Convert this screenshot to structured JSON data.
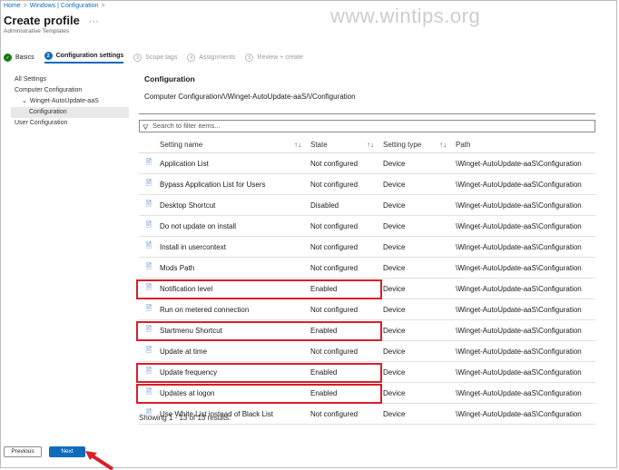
{
  "breadcrumb": [
    "Home",
    "Windows | Configuration"
  ],
  "page_title": "Create profile",
  "subtitle": "Administrative Templates",
  "watermark": "www.wintips.org",
  "steps": [
    {
      "label": "Basics",
      "state": "done",
      "num": "✓"
    },
    {
      "label": "Configuration settings",
      "state": "active",
      "num": "2"
    },
    {
      "label": "Scope tags",
      "state": "pending",
      "num": "3"
    },
    {
      "label": "Assignments",
      "state": "pending",
      "num": "4"
    },
    {
      "label": "Review + create",
      "state": "pending",
      "num": "5"
    }
  ],
  "tree": [
    {
      "label": "All Settings",
      "indent": 0
    },
    {
      "label": "Computer Configuration",
      "indent": 0
    },
    {
      "label": "Winget-AutoUpdate-aaS",
      "indent": 1
    },
    {
      "label": "Configuration",
      "indent": 2,
      "selected": true
    },
    {
      "label": "User Configuration",
      "indent": 0
    }
  ],
  "section_title": "Configuration",
  "section_path": "Computer Configuration/\\/Winget-AutoUpdate-aaS/\\/Configuration",
  "filter_placeholder": "Search to filter items...",
  "columns": {
    "setting": "Setting name",
    "state": "State",
    "type": "Setting type",
    "path": "Path"
  },
  "rows": [
    {
      "name": "Application List",
      "state": "Not configured",
      "type": "Device",
      "path": "\\Winget-AutoUpdate-aaS\\Configuration"
    },
    {
      "name": "Bypass Application List for Users",
      "state": "Not configured",
      "type": "Device",
      "path": "\\Winget-AutoUpdate-aaS\\Configuration"
    },
    {
      "name": "Desktop Shortcut",
      "state": "Disabled",
      "type": "Device",
      "path": "\\Winget-AutoUpdate-aaS\\Configuration"
    },
    {
      "name": "Do not update on install",
      "state": "Not configured",
      "type": "Device",
      "path": "\\Winget-AutoUpdate-aaS\\Configuration"
    },
    {
      "name": "Install in usercontext",
      "state": "Not configured",
      "type": "Device",
      "path": "\\Winget-AutoUpdate-aaS\\Configuration"
    },
    {
      "name": "Mods Path",
      "state": "Not configured",
      "type": "Device",
      "path": "\\Winget-AutoUpdate-aaS\\Configuration"
    },
    {
      "name": "Notification level",
      "state": "Enabled",
      "type": "Device",
      "path": "\\Winget-AutoUpdate-aaS\\Configuration",
      "highlight": true
    },
    {
      "name": "Run on metered connection",
      "state": "Not configured",
      "type": "Device",
      "path": "\\Winget-AutoUpdate-aaS\\Configuration"
    },
    {
      "name": "Startmenu Shortcut",
      "state": "Enabled",
      "type": "Device",
      "path": "\\Winget-AutoUpdate-aaS\\Configuration",
      "highlight": true
    },
    {
      "name": "Update at time",
      "state": "Not configured",
      "type": "Device",
      "path": "\\Winget-AutoUpdate-aaS\\Configuration"
    },
    {
      "name": "Update frequency",
      "state": "Enabled",
      "type": "Device",
      "path": "\\Winget-AutoUpdate-aaS\\Configuration",
      "highlight": true
    },
    {
      "name": "Updates at logon",
      "state": "Enabled",
      "type": "Device",
      "path": "\\Winget-AutoUpdate-aaS\\Configuration",
      "highlight": true
    },
    {
      "name": "Use White List instead of Black List",
      "state": "Not configured",
      "type": "Device",
      "path": "\\Winget-AutoUpdate-aaS\\Configuration"
    }
  ],
  "footer_text": "Showing 1 - 13 of 13 results.",
  "buttons": {
    "previous": "Previous",
    "next": "Next"
  },
  "colors": {
    "accent": "#0f6cbd",
    "highlight": "#d91e2a",
    "done": "#107c10"
  }
}
